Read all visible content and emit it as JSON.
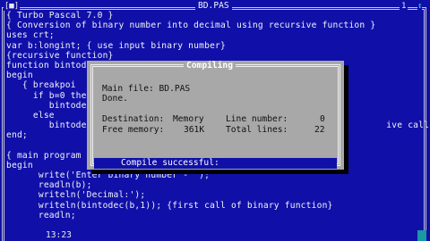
{
  "window": {
    "close": "[■]",
    "title": "BD.PAS",
    "number": "1",
    "zoom": "↕"
  },
  "code_lines": [
    "{ Turbo Pascal 7.0 }",
    "{ Conversion of binary number into decimal using recursive function }",
    "uses crt;",
    "var b:longint; { use input binary number}",
    "{recursive function}",
    "function bintode",
    "begin",
    "   { breakpoi",
    "     if b=0 the",
    "        bintode",
    "     else",
    "        bintode                                                        ive call)",
    "end;",
    "",
    "{ main program",
    "begin",
    "      write('Enter binary number - ');",
    "      readln(b);",
    "      writeln('Decimal:');",
    "      writeln(bintodec(b,1)); {first call of binary function}",
    "      readln;"
  ],
  "status": {
    "cursor": "13:23"
  },
  "dialog": {
    "title": "Compiling",
    "main_file_label": "Main file: BD.PAS",
    "done_label": "Done.",
    "destination_label": "Destination:",
    "destination_value": "Memory",
    "line_number_label": "Line number:",
    "line_number_value": "0",
    "free_memory_label": "Free memory:",
    "free_memory_value": "361K",
    "total_lines_label": "Total lines:",
    "total_lines_value": "22",
    "result": "Compile successful:"
  },
  "colors": {
    "editor_bg": "#1010a8",
    "dialog_bg": "#a8a8a8",
    "status_bar_bg": "#1010a8"
  }
}
